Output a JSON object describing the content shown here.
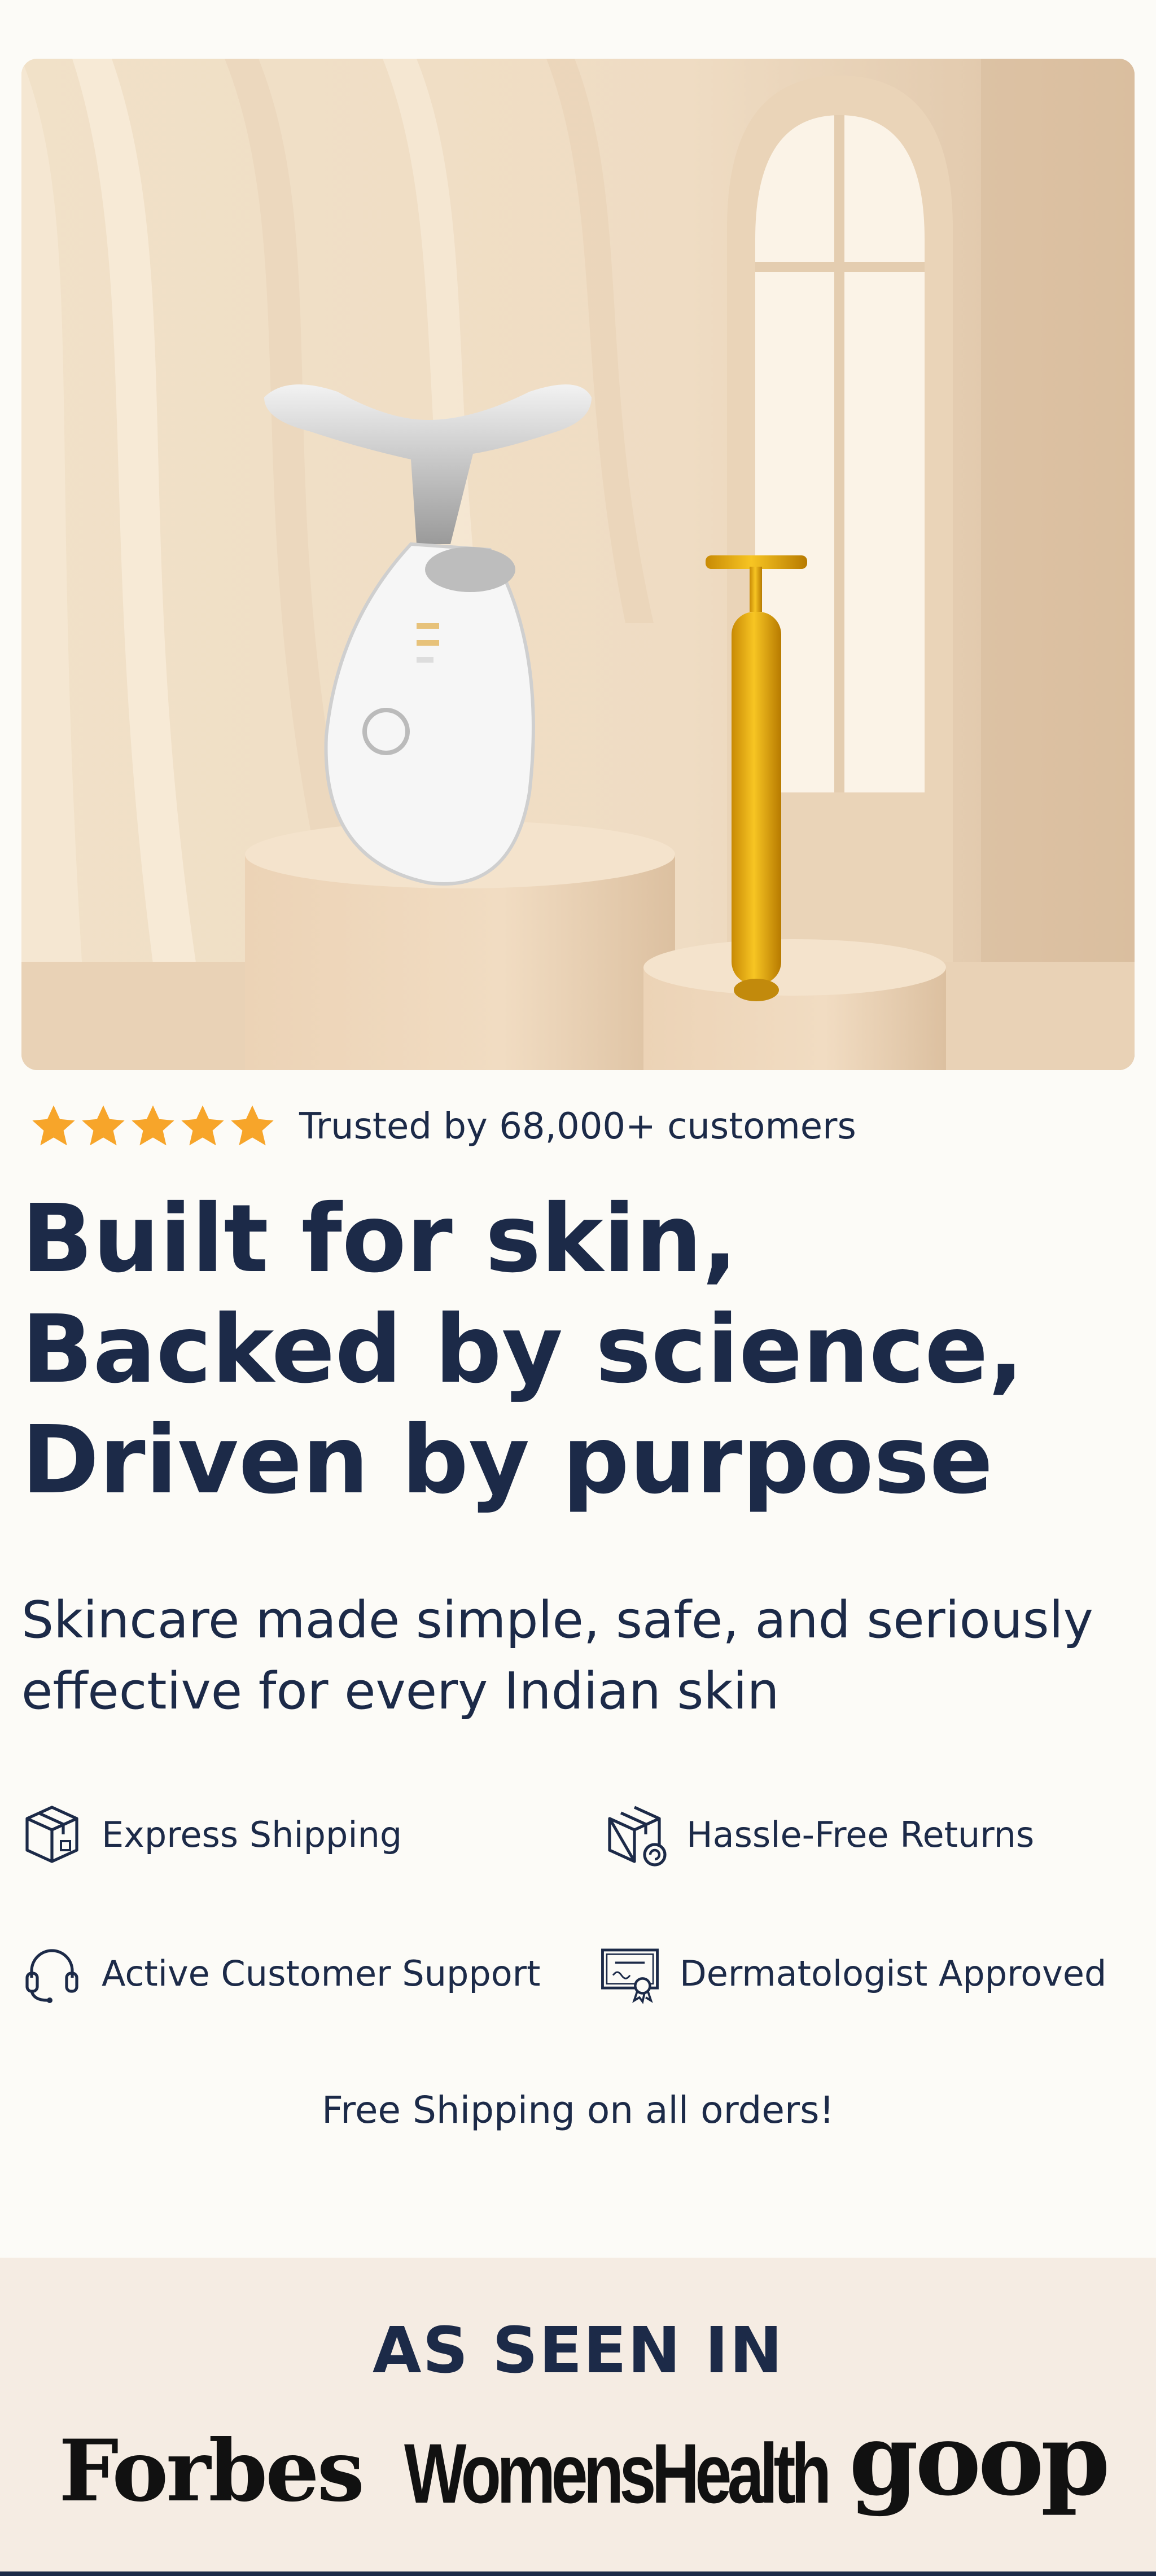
{
  "rating": {
    "stars": 5,
    "text": "Trusted by 68,000+ customers"
  },
  "headline": "Built for skin, Backed by science, Driven by purpose",
  "subheadline": "Skincare made simple, safe, and seriously effective for every Indian skin",
  "features": [
    {
      "label": "Express Shipping",
      "icon": "box-icon"
    },
    {
      "label": "Hassle-Free Returns",
      "icon": "return-box-icon"
    },
    {
      "label": "Active Customer Support",
      "icon": "headset-icon"
    },
    {
      "label": "Dermatologist Approved",
      "icon": "certificate-icon"
    }
  ],
  "shipping_note": "Free Shipping on all orders!",
  "press": {
    "title": "AS SEEN IN",
    "logos": [
      "Forbes",
      "WomensHealth",
      "goop"
    ]
  },
  "colors": {
    "text": "#1c2a48",
    "star": "#f7a52a",
    "page_bg": "#fcfbf7",
    "press_bg": "#f5ece3"
  }
}
